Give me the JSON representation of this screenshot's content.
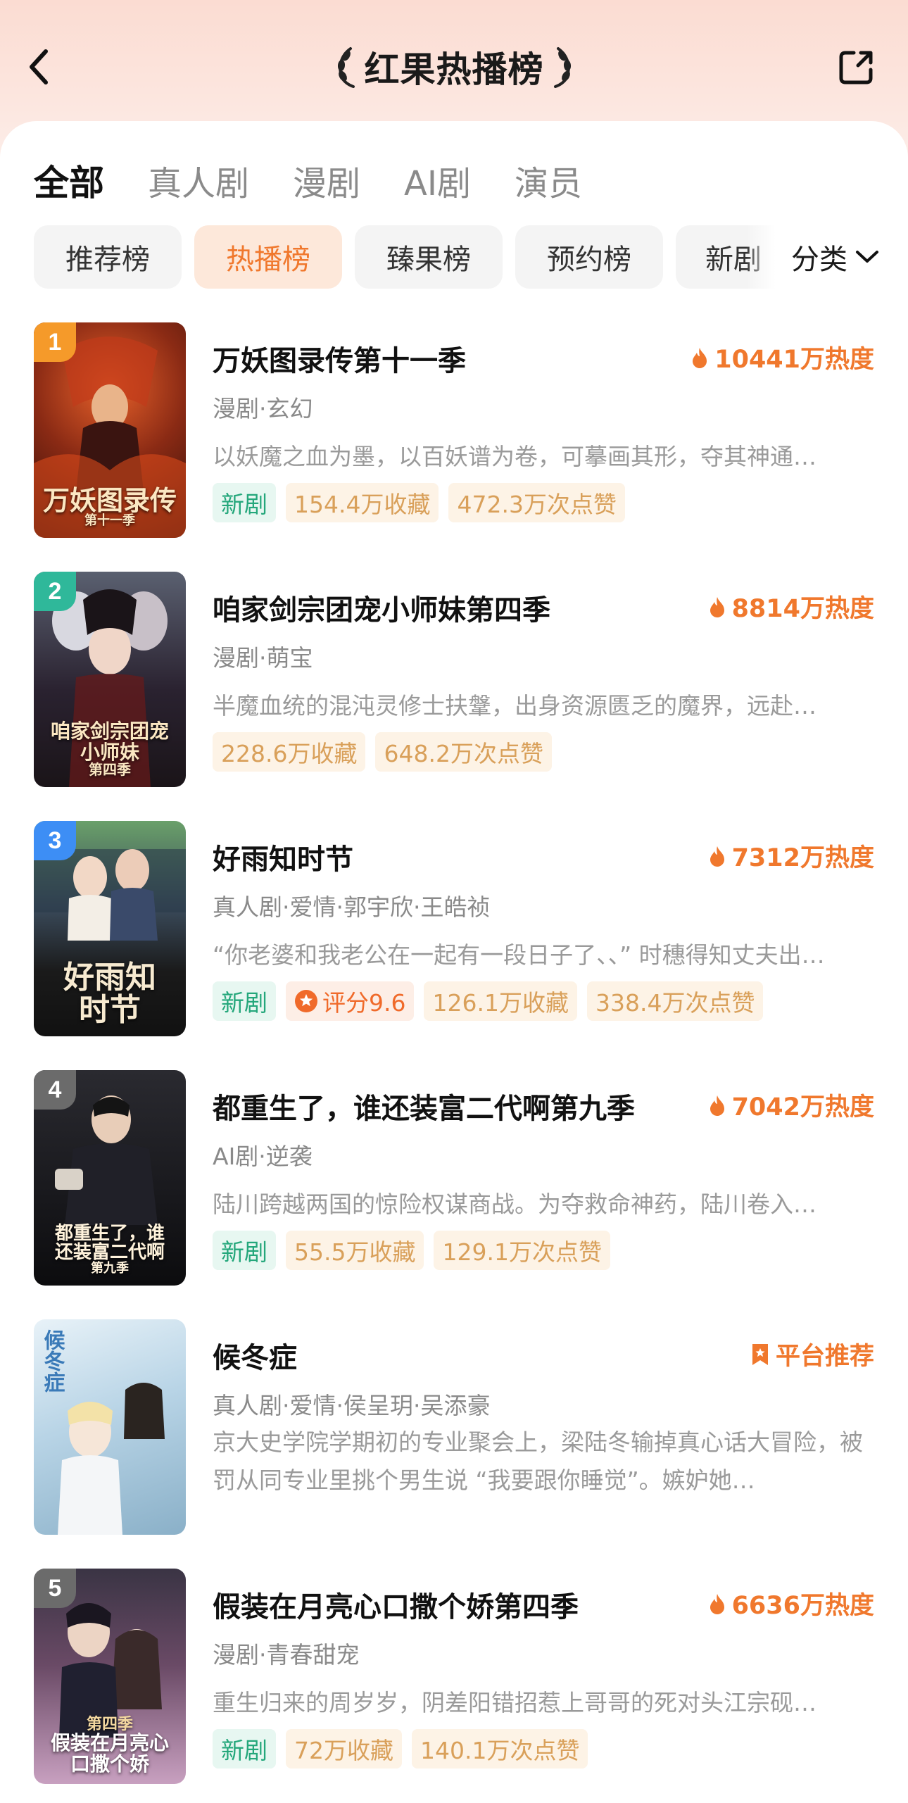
{
  "header": {
    "title": "红果热播榜"
  },
  "tabs": [
    "全部",
    "真人剧",
    "漫剧",
    "AI剧",
    "演员"
  ],
  "chips": [
    "推荐榜",
    "热播榜",
    "臻果榜",
    "预约榜",
    "新剧"
  ],
  "category": "分类",
  "items": [
    {
      "rank": "1",
      "name": "万妖图录传第十一季",
      "heat": "10441万热度",
      "meta": "漫剧·玄幻",
      "desc": "以妖魔之血为墨，以百妖谱为卷，可摹画其形，夺其神通…",
      "tags": {
        "new": "新剧",
        "fav": "154.4万收藏",
        "like": "472.3万次点赞"
      },
      "cover_title": "万妖图录传",
      "cover_sub": "第十一季"
    },
    {
      "rank": "2",
      "name": "咱家剑宗团宠小师妹第四季",
      "heat": "8814万热度",
      "meta": "漫剧·萌宝",
      "desc": "半魔血统的混沌灵修士扶鞶，出身资源匮乏的魔界，远赴…",
      "tags": {
        "fav": "228.6万收藏",
        "like": "648.2万次点赞"
      },
      "cover_title": "咱家剑宗团宠小师妹",
      "cover_sub": "第四季"
    },
    {
      "rank": "3",
      "name": "好雨知时节",
      "heat": "7312万热度",
      "meta": "真人剧·爱情·郭宇欣·王皓祯",
      "desc": "“你老婆和我老公在一起有一段日子了、、” 时穗得知丈夫出…",
      "tags": {
        "new": "新剧",
        "score": "评分9.6",
        "fav": "126.1万收藏",
        "like": "338.4万次点赞"
      },
      "cover_title": "好雨知时节"
    },
    {
      "rank": "4",
      "name": "都重生了，谁还装富二代啊第九季",
      "heat": "7042万热度",
      "meta": "AI剧·逆袭",
      "desc": "陆川跨越两国的惊险权谋商战。为夺救命神药，陆川卷入…",
      "tags": {
        "new": "新剧",
        "fav": "55.5万收藏",
        "like": "129.1万次点赞"
      },
      "cover_title": "都重生了，谁还装富二代啊",
      "cover_sub": "第九季"
    },
    {
      "name": "候冬症",
      "promo": "平台推荐",
      "meta": "真人剧·爱情·侯呈玥·吴添豪",
      "desc": "京大史学院学期初的专业聚会上，梁陆冬输掉真心话大冒险，被罚从同专业里挑个男生说 “我要跟你睡觉”。嫉妒她…",
      "cover_title": "候冬症"
    },
    {
      "rank": "5",
      "name": "假装在月亮心口撒个娇第四季",
      "heat": "6636万热度",
      "meta": "漫剧·青春甜宠",
      "desc": "重生归来的周岁岁，阴差阳错招惹上哥哥的死对头江宗砚…",
      "tags": {
        "new": "新剧",
        "fav": "72万收藏",
        "like": "140.1万次点赞"
      },
      "cover_title": "假装在月亮心口撒个娇",
      "cover_sub": "第四季"
    }
  ],
  "colors": {
    "accent": "#f0782d",
    "rank1": "#f59a2a",
    "rank2": "#2fb89a",
    "rank3": "#3d8ef5",
    "rank_other": "#6b6b6b",
    "new_tag": "#24a77b"
  }
}
